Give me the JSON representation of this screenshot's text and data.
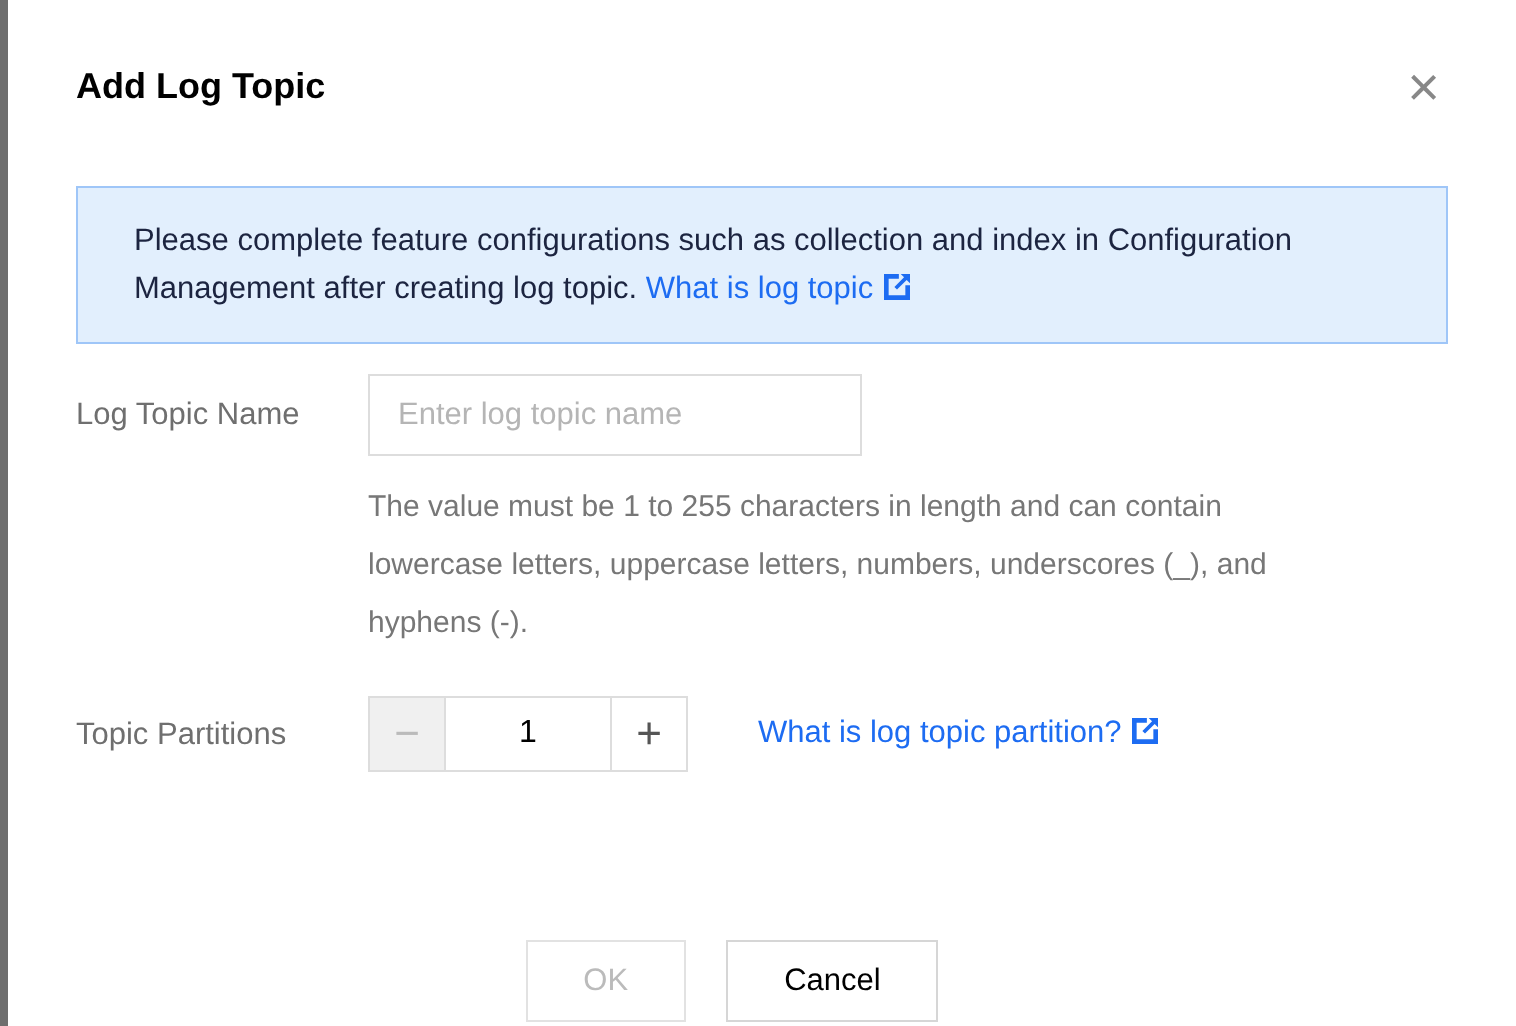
{
  "dialog": {
    "title": "Add Log Topic",
    "close": "×"
  },
  "alert": {
    "text": "Please complete feature configurations such as collection and index in Configuration Management after creating log topic.",
    "link": "What is log topic"
  },
  "fields": [
    {
      "kind": "text",
      "label": "Log Topic Name",
      "placeholder": "Enter log topic name",
      "help": "The value must be 1 to 255 characters in length and can contain lowercase letters, uppercase letters, numbers, underscores (_), and hyphens (-)."
    },
    {
      "kind": "stepper",
      "label": "Topic Partitions",
      "value": "1",
      "minus": {
        "label": "−",
        "disabled": true
      },
      "plus": {
        "label": "+",
        "disabled": false
      },
      "link": "What is log topic partition?"
    }
  ],
  "buttons": [
    {
      "label": "OK",
      "disabled": true
    },
    {
      "label": "Cancel",
      "disabled": false
    }
  ]
}
